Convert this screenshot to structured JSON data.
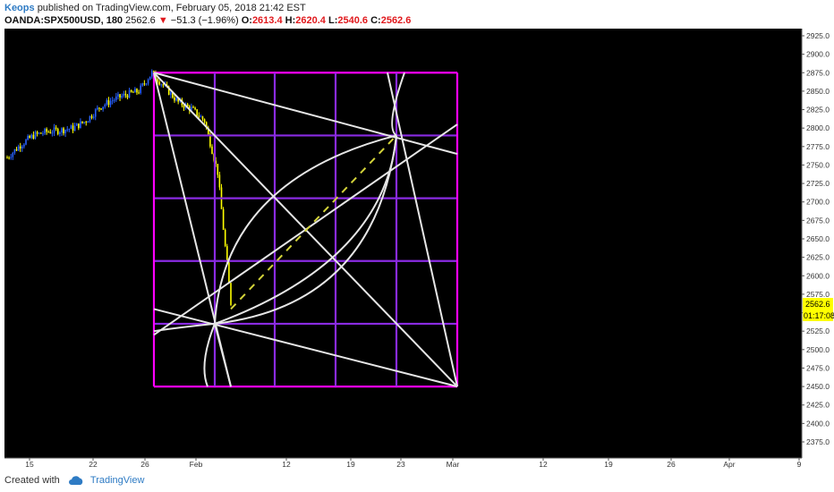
{
  "header": {
    "author": "Keops",
    "published_text": "published on TradingView.com, February 05, 2018 21:42 EST",
    "symbol": "OANDA:SPX500USD, 180",
    "last": "2562.6",
    "change": "−51.3 (−1.96%)",
    "open_label": "O:",
    "open": "2613.4",
    "high_label": "H:",
    "high": "2620.4",
    "low_label": "L:",
    "low": "2540.6",
    "close_label": "C:",
    "close": "2562.6"
  },
  "price_axis": {
    "ticks": [
      "2925.0",
      "2900.0",
      "2875.0",
      "2850.0",
      "2825.0",
      "2800.0",
      "2775.0",
      "2750.0",
      "2725.0",
      "2700.0",
      "2675.0",
      "2650.0",
      "2625.0",
      "2600.0",
      "2575.0",
      "2550.0",
      "2525.0",
      "2500.0",
      "2475.0",
      "2450.0",
      "2425.0",
      "2400.0",
      "2375.0"
    ],
    "price_label": "2562.6",
    "countdown_label": "01:17:08"
  },
  "time_axis": {
    "ticks": [
      "15",
      "22",
      "26",
      "Feb",
      "12",
      "19",
      "23",
      "Mar",
      "12",
      "19",
      "26",
      "Apr",
      "9"
    ]
  },
  "colors": {
    "background": "#000000",
    "bull_candle": "#2962ff",
    "bear_candle": "#ffff00",
    "grid_outer": "#ff00ff",
    "grid_inner": "#8a2be2",
    "geometry": "#e6e6e6",
    "dashed_line": "#d4d43a",
    "price_label_bg": "#ffff00"
  },
  "chart_data": {
    "type": "line",
    "title": "",
    "xlabel": "",
    "ylabel": "",
    "ylim": [
      2360,
      2940
    ],
    "x": [
      "Jan 11",
      "Jan 12",
      "Jan 15",
      "Jan 16",
      "Jan 17",
      "Jan 18",
      "Jan 19",
      "Jan 22",
      "Jan 23",
      "Jan 24",
      "Jan 25",
      "Jan 26",
      "Jan 29",
      "Jan 30",
      "Jan 31",
      "Feb 1",
      "Feb 2",
      "Feb 5"
    ],
    "series": [
      {
        "values": [
          2760,
          2777,
          2790,
          2795,
          2797,
          2800,
          2810,
          2828,
          2838,
          2845,
          2850,
          2875,
          2855,
          2835,
          2826,
          2810,
          2740,
          2563
        ]
      }
    ],
    "square": {
      "top": 2875,
      "bottom": 2450,
      "start": "Jan 26",
      "end": "Mar 1"
    },
    "grid_levels": [
      2875,
      2790,
      2705,
      2620,
      2535,
      2450
    ]
  },
  "footer": {
    "created_with": "Created with",
    "brand": "TradingView"
  }
}
